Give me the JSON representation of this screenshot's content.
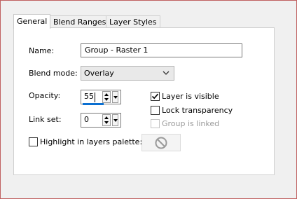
{
  "tabs": [
    "General",
    "Blend Ranges",
    "Layer Styles"
  ],
  "active_tab": "General",
  "name": {
    "label": "Name:",
    "value": "Group - Raster 1"
  },
  "blend_mode": {
    "label": "Blend mode:",
    "value": "Overlay"
  },
  "opacity": {
    "label": "Opacity:",
    "value": "55",
    "level_percent": 55
  },
  "link_set": {
    "label": "Link set:",
    "value": "0"
  },
  "checkboxes": {
    "layer_visible": {
      "label": "Layer is visible",
      "checked": true,
      "enabled": true
    },
    "lock_transparency": {
      "label": "Lock transparency",
      "checked": false,
      "enabled": true
    },
    "group_linked": {
      "label": "Group is linked",
      "checked": false,
      "enabled": false
    }
  },
  "highlight": {
    "label": "Highlight in layers palette:",
    "checked": false
  },
  "icons": {
    "spin_up": "spin-up-arrow-icon",
    "spin_down": "spin-down-arrow-icon",
    "dropdown": "chevron-down-icon",
    "check": "checkmark-icon",
    "no_color": "no-color-icon"
  },
  "colors": {
    "accent": "#0a6fd1",
    "frame_border": "#c06060"
  }
}
